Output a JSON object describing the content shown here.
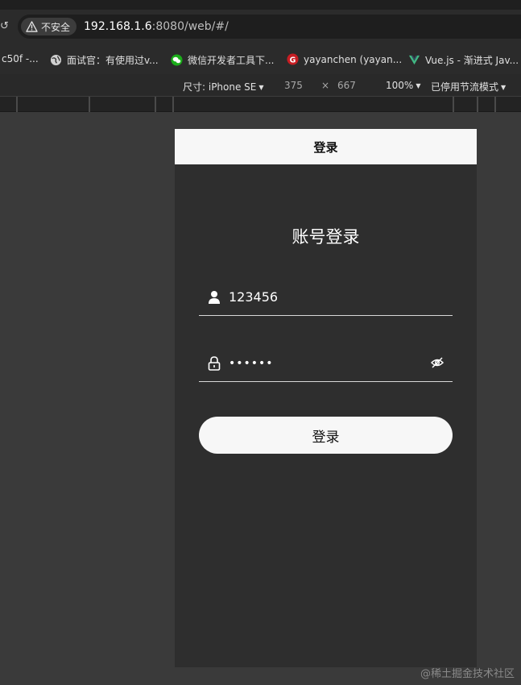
{
  "browser": {
    "security_chip": "不安全",
    "url_host": "192.168.1.6",
    "url_rest": ":8080/web/#/",
    "bookmarks": [
      {
        "label": "c50f -...",
        "icon": "page-icon"
      },
      {
        "label": "面试官：有使用过v...",
        "icon": "globe-icon"
      },
      {
        "label": "微信开发者工具下...",
        "icon": "wechat-icon"
      },
      {
        "label": "yayanchen (yayan...",
        "icon": "gitee-icon"
      },
      {
        "label": "Vue.js - 渐进式 Jav...",
        "icon": "vue-icon"
      }
    ]
  },
  "device_toolbar": {
    "dimensions_label": "尺寸: iPhone SE",
    "width": "375",
    "times": "×",
    "height": "667",
    "zoom": "100%",
    "throttle": "已停用节流模式"
  },
  "app": {
    "nav_title": "登录",
    "heading": "账号登录",
    "username_value": "123456",
    "password_dots": "••••••",
    "login_button": "登录"
  },
  "watermark": "@稀土掘金技术社区",
  "colors": {
    "page_bg": "#3a3a3a",
    "phone_bg": "#2e2e2e",
    "nav_bg": "#f7f7f7",
    "button_bg": "#f7f7f7"
  }
}
